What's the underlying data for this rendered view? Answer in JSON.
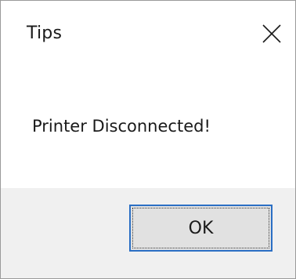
{
  "dialog": {
    "title": "Tips",
    "close_icon": "close-icon",
    "message": "Printer Disconnected!",
    "ok_label": "OK",
    "colors": {
      "background": "#ffffff",
      "footer_background": "#f0f0f0",
      "button_background": "#e1e1e1",
      "button_focus_border": "#2b6fc4",
      "text": "#1a1a1a"
    }
  }
}
